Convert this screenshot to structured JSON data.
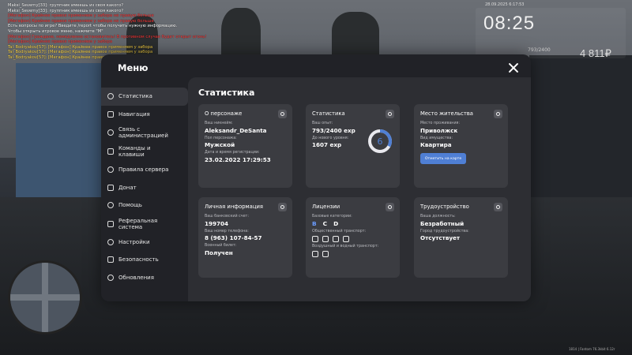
{
  "hud": {
    "time": "08:25",
    "date": "28.09.2025 6:17:53",
    "money": "4 811₽",
    "stat": "793/2400",
    "version": "1814 | Fantom 76.3kbit 6.12r"
  },
  "chat": [
    {
      "text": "Maksi_Severny[33]: группник имеешь из своя какого?",
      "color": "#ffffff"
    },
    {
      "text": "Maksi_Severny[33]: группник имеешь из своя какого?",
      "color": "#ffffff"
    },
    {
      "text": "[Мегафон] Крайнее правое применяем у забора не правую больше",
      "color": "#ff3b3b"
    },
    {
      "text": "[Мегафон] Крайнее правое применяем у забора не правую больше",
      "color": "#ff3b3b"
    },
    {
      "text": "Есть вопросы по игре? Введите /report чтобы получить нужную информацию.",
      "color": "#ffffff"
    },
    {
      "text": "Чтобы открыть игровое меню, нажмите \"M\"",
      "color": "#ffffff"
    },
    {
      "text": "[Мегафон] Граждане, немедленно остановитесь! В противном случае будет открыт огонь!",
      "color": "#ff3b3b"
    },
    {
      "text": "[Мегафон] Крайнее правое применяем у забора",
      "color": "#ff3b3b"
    },
    {
      "text": "Tal_Bodryakov[57]: [Мегафон] Крайнее правое применяем у забора",
      "color": "#ffd84a"
    },
    {
      "text": "Tal_Bodryakov[57]: [Мегафон] Крайнее правое применяем у забора",
      "color": "#ffd84a"
    },
    {
      "text": "Tal_Bodryakov[57]: [Мегафон] Крайнее правое применяем у забора",
      "color": "#ffd84a"
    }
  ],
  "menu": {
    "title": "Меню",
    "sidebar": [
      {
        "label": "Статистика",
        "icon": "stats-icon",
        "active": true
      },
      {
        "label": "Навигация",
        "icon": "navigation-icon"
      },
      {
        "label": "Связь с\nадминистрацией",
        "icon": "headset-icon"
      },
      {
        "label": "Команды и\nклавиши",
        "icon": "keyboard-icon"
      },
      {
        "label": "Правила сервера",
        "icon": "rules-icon"
      },
      {
        "label": "Донат",
        "icon": "donate-icon"
      },
      {
        "label": "Помощь",
        "icon": "help-icon"
      },
      {
        "label": "Реферальная\nсистема",
        "icon": "referral-icon"
      },
      {
        "label": "Настройки",
        "icon": "settings-icon"
      },
      {
        "label": "Безопасность",
        "icon": "shield-icon"
      },
      {
        "label": "Обновления",
        "icon": "updates-icon"
      }
    ],
    "content_title": "Статистика",
    "cards": {
      "about": {
        "title": "О персонаже",
        "nick_label": "Ваш никнейм:",
        "nick": "Aleksandr_DeSanta",
        "sex_label": "Пол персонажа:",
        "sex": "Мужской",
        "reg_label": "Дата и время регистрации:",
        "reg": "23.02.2022 17:29:53"
      },
      "stats": {
        "title": "Статистика",
        "exp_label": "Ваш опыт:",
        "exp": "793/2400 exp",
        "next_label": "До нового уровня:",
        "next": "1607 exp",
        "level": "6",
        "progress": 0.33
      },
      "residence": {
        "title": "Место жительства",
        "place_label": "Место проживания:",
        "place": "Приволжск",
        "prop_label": "Вид имущества:",
        "prop": "Квартира",
        "button": "Отметить на карте"
      },
      "personal": {
        "title": "Личная информация",
        "bank_label": "Ваш банковский счет:",
        "bank": "199704",
        "phone_label": "Ваш номер телефона:",
        "phone": "8 (963) 107-84-57",
        "military_label": "Военный билет:",
        "military": "Получен"
      },
      "licenses": {
        "title": "Лицензии",
        "base_label": "Базовые категории:",
        "categories": [
          "B",
          "C",
          "D"
        ],
        "public_label": "Общественный транспорт:",
        "air_label": "Воздушный и водный транспорт:"
      },
      "job": {
        "title": "Трудоустройство",
        "position_label": "Ваша должность:",
        "position": "Безработный",
        "city_label": "Город трудоустройства:",
        "city": "Отсутствует"
      }
    }
  }
}
